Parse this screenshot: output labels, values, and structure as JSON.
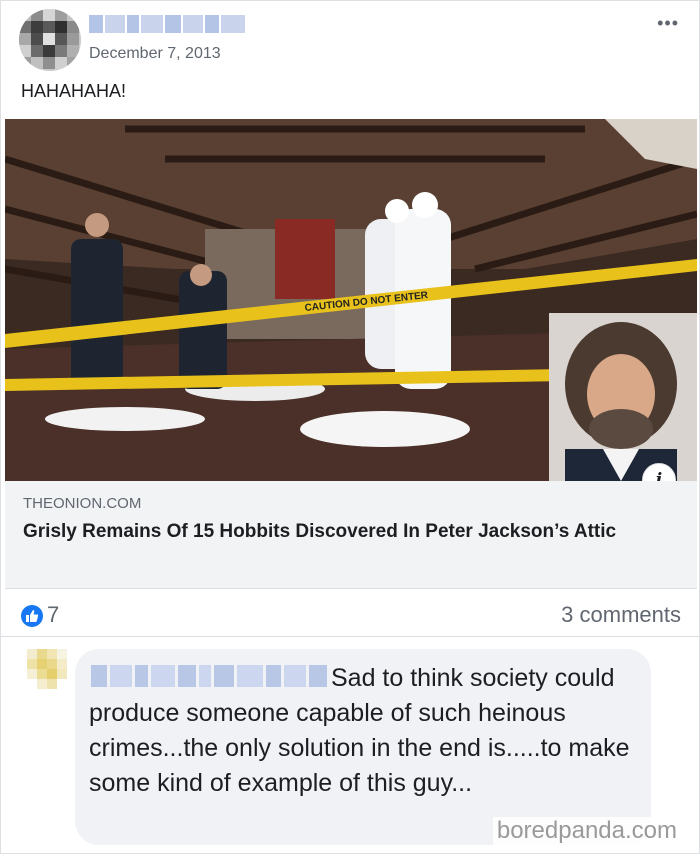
{
  "post": {
    "date": "December 7, 2013",
    "more_label": "•••",
    "text": "HAHAHAHA!",
    "link": {
      "domain": "THEONION.COM",
      "headline": "Grisly Remains Of 15 Hobbits Discovered In Peter Jackson’s Attic",
      "info_label": "i",
      "image_tape_text": "CAUTION DO NOT ENTER"
    },
    "reactions": {
      "like_count": "7",
      "comments_label": "3 comments"
    }
  },
  "comment": {
    "text": "Sad to think society could produce someone capable of such heinous crimes...the only solution in the end is.....to make some kind of example of this guy..."
  },
  "watermark": "boredpanda.com",
  "colors": {
    "like_blue": "#1877f2",
    "tape_yellow": "#e8c21a",
    "bubble_gray": "#f0f2f5",
    "link_box_gray": "#f2f3f5"
  }
}
